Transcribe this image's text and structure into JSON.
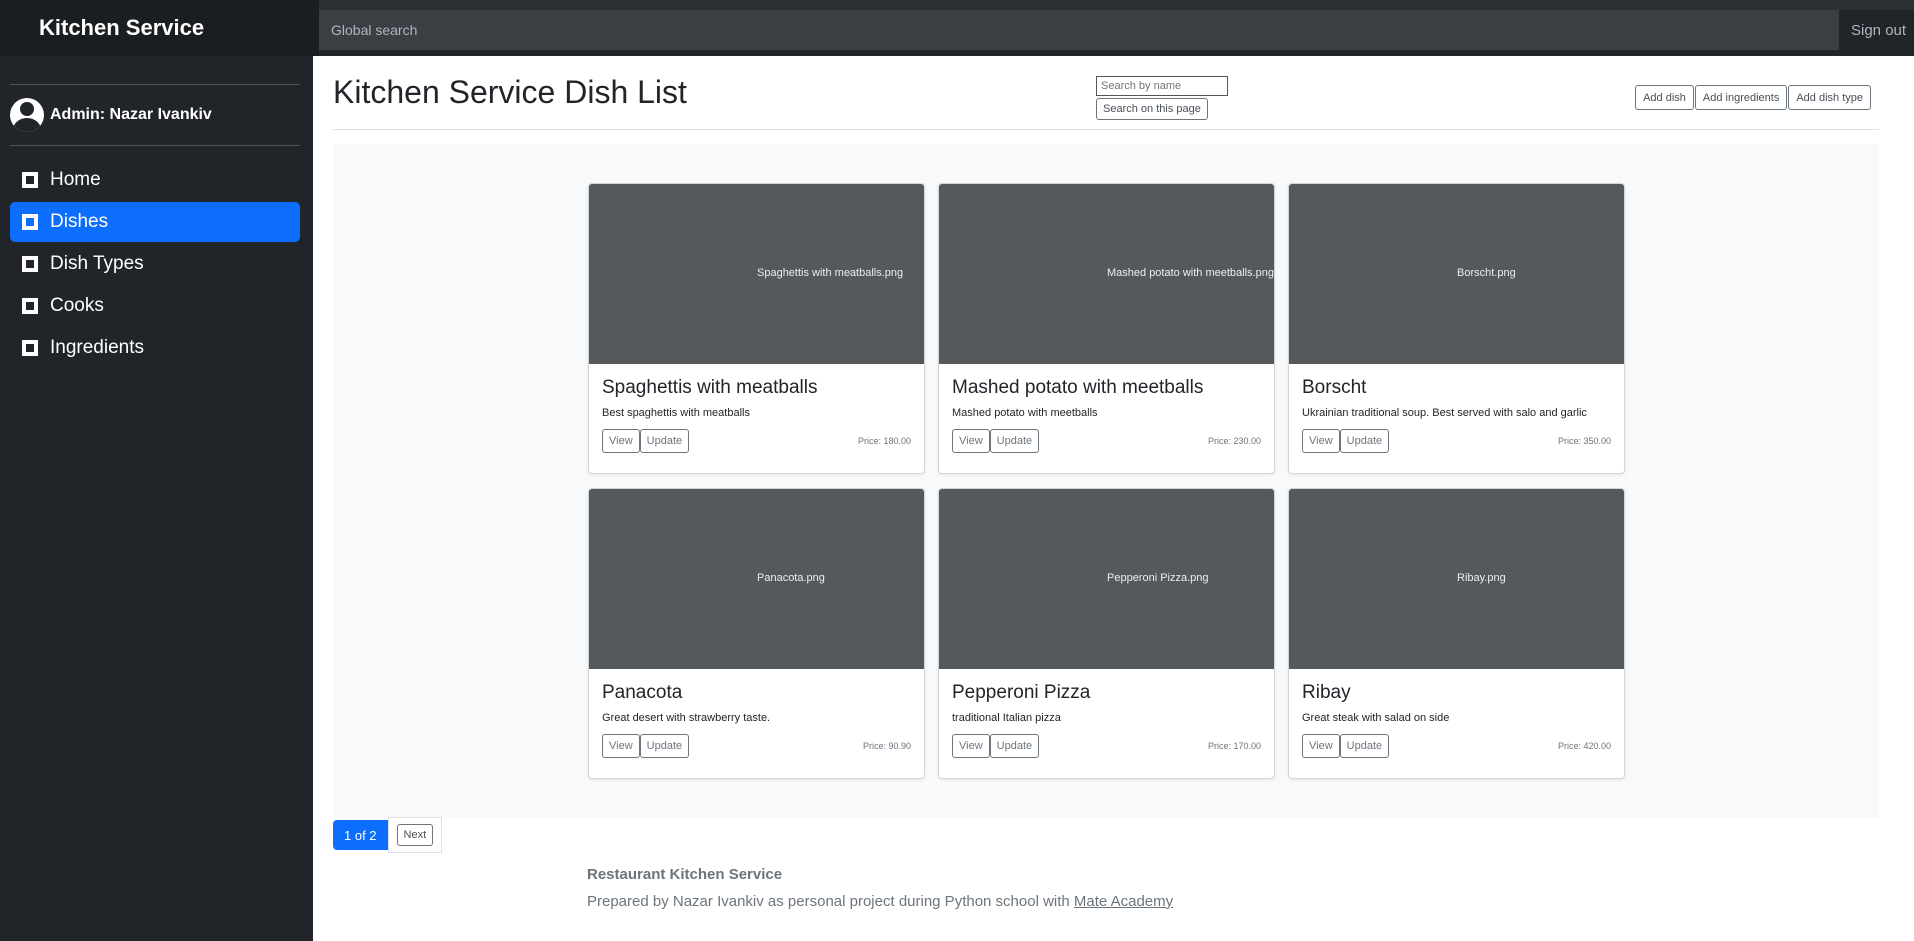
{
  "app": {
    "brand": "Kitchen Service"
  },
  "topbar": {
    "search_placeholder": "Global search",
    "signout_label": "Sign out"
  },
  "sidebar": {
    "user_label": "Admin: Nazar Ivankiv",
    "items": [
      {
        "label": "Home",
        "icon": "home-icon",
        "active": false
      },
      {
        "label": "Dishes",
        "icon": "dishes-icon",
        "active": true
      },
      {
        "label": "Dish Types",
        "icon": "dish-types-icon",
        "active": false
      },
      {
        "label": "Cooks",
        "icon": "cooks-icon",
        "active": false
      },
      {
        "label": "Ingredients",
        "icon": "ingredients-icon",
        "active": false
      }
    ]
  },
  "main": {
    "title": "Kitchen Service Dish List",
    "search": {
      "placeholder": "Search by name",
      "button_label": "Search on this page"
    },
    "actions": {
      "add_dish": "Add dish",
      "add_ingredients": "Add ingredients",
      "add_dish_type": "Add dish type"
    },
    "cards": [
      {
        "image": "Spaghettis with meatballs.png",
        "title": "Spaghettis with meatballs",
        "description": "Best spaghettis with meatballs",
        "view": "View",
        "update": "Update",
        "price": "Price: 180.00"
      },
      {
        "image": "Mashed potato with meetballs.png",
        "title": "Mashed potato with meetballs",
        "description": "Mashed potato with meetballs",
        "view": "View",
        "update": "Update",
        "price": "Price: 230.00"
      },
      {
        "image": "Borscht.png",
        "title": "Borscht",
        "description": "Ukrainian traditional soup. Best served with salo and garlic",
        "view": "View",
        "update": "Update",
        "price": "Price: 350.00"
      },
      {
        "image": "Panacota.png",
        "title": "Panacota",
        "description": "Great desert with strawberry taste.",
        "view": "View",
        "update": "Update",
        "price": "Price: 90.90"
      },
      {
        "image": "Pepperoni Pizza.png",
        "title": "Pepperoni Pizza",
        "description": "traditional Italian pizza",
        "view": "View",
        "update": "Update",
        "price": "Price: 170.00"
      },
      {
        "image": "Ribay.png",
        "title": "Ribay",
        "description": "Great steak with salad on side",
        "view": "View",
        "update": "Update",
        "price": "Price: 420.00"
      }
    ],
    "pagination": {
      "current": "1 of 2",
      "next": "Next"
    },
    "footer": {
      "title": "Restaurant Kitchen Service",
      "text": "Prepared by Nazar Ivankiv as personal project during Python school with ",
      "link": "Mate Academy"
    }
  },
  "colors": {
    "primary": "#0d6efd",
    "sidebar_bg": "#212529",
    "image_placeholder": "#55595c"
  }
}
